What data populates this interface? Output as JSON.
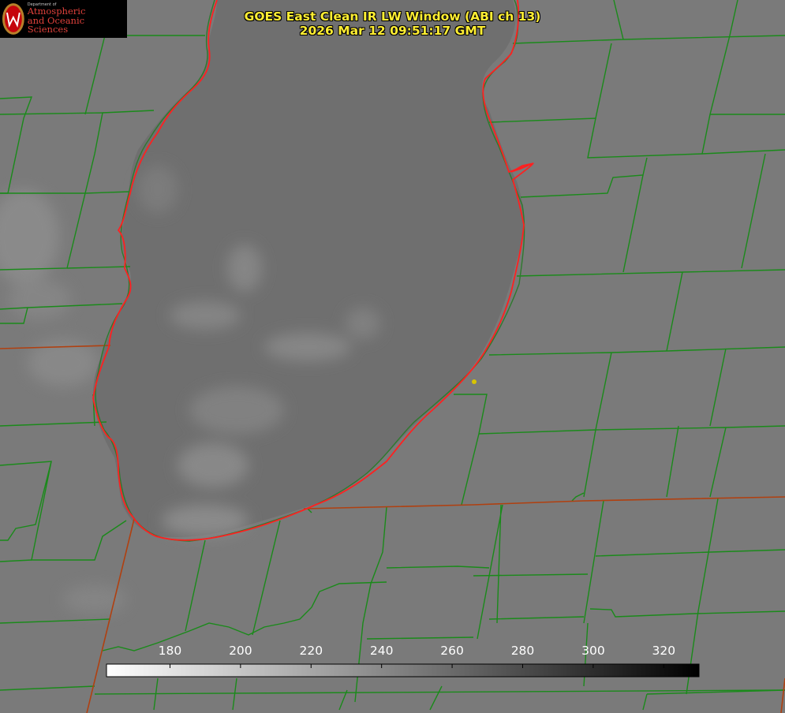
{
  "header": {
    "title_line1": "GOES East Clean IR LW Window (ABI ch 13)",
    "title_line2": "2026 Mar 12 09:51:17 GMT"
  },
  "logo": {
    "department": "Department of",
    "line1": "Atmospheric",
    "line2": "and Oceanic Sciences",
    "seal_letter": "W"
  },
  "colorbar": {
    "ticks": [
      180,
      200,
      220,
      240,
      260,
      280,
      300,
      320
    ],
    "min": 162,
    "max": 330
  },
  "colors": {
    "title": "#ffee33",
    "county_lines": "#1a8a1a",
    "state_lines": "#b04010",
    "lake_shoreline": "#ff2020",
    "marker": "#d8c400"
  }
}
